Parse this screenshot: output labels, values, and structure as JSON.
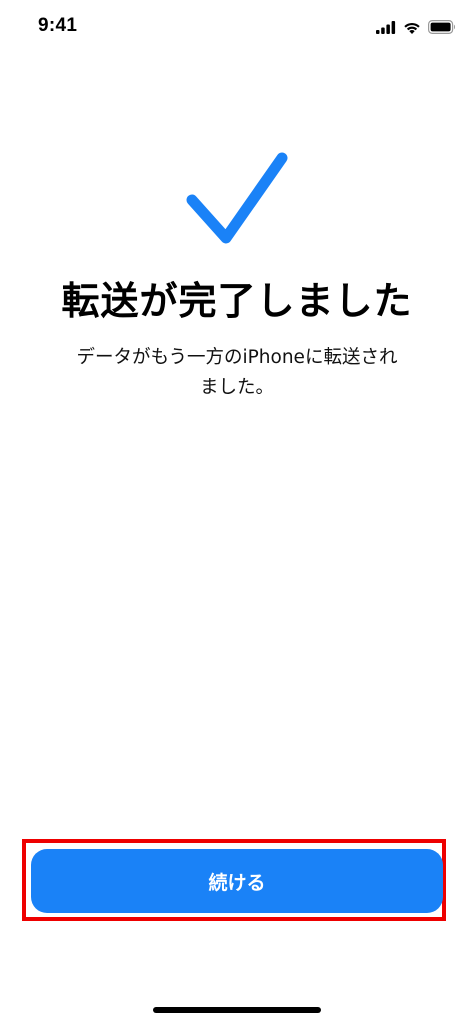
{
  "status_bar": {
    "time": "9:41",
    "icons": [
      "cellular-signal-icon",
      "wifi-icon",
      "battery-icon"
    ]
  },
  "main": {
    "icon": "checkmark-icon",
    "title": "転送が完了しました",
    "description_line1": "データがもう一方のiPhoneに転送され",
    "description_line2": "ました。"
  },
  "footer": {
    "continue_label": "続ける"
  },
  "colors": {
    "accent": "#1a82f7",
    "highlight_border": "#ee0000",
    "background": "#ffffff"
  }
}
